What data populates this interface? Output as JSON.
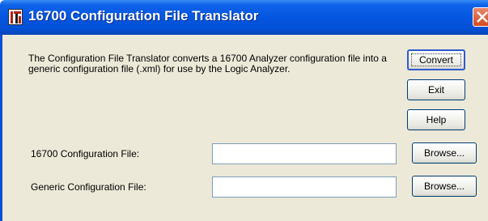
{
  "window": {
    "title": "16700 Configuration File Translator",
    "app_icon": "ti-glyph-icon",
    "close_icon": "close-icon"
  },
  "description": "The Configuration File Translator converts a 16700 Analyzer configuration file into a generic configuration file (.xml) for use by the Logic Analyzer.",
  "buttons": {
    "convert": "Convert",
    "exit": "Exit",
    "help": "Help"
  },
  "fields": [
    {
      "label": "16700 Configuration File:",
      "value": "",
      "browse": "Browse..."
    },
    {
      "label": "Generic Configuration File:",
      "value": "",
      "browse": "Browse..."
    }
  ],
  "colors": {
    "titlebar": "#0556e0",
    "dialog_bg": "#ece9d8",
    "close_button": "#d54a1e"
  }
}
